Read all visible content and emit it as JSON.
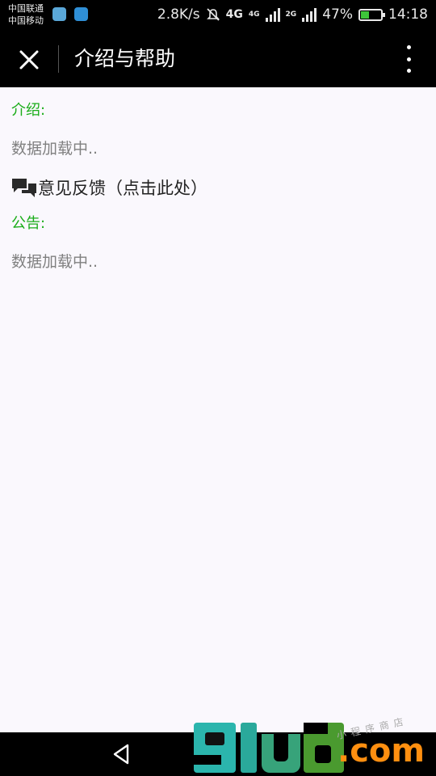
{
  "status_bar": {
    "carrier1": "中国联通",
    "carrier2": "中国移动",
    "speed": "2.8K/s",
    "net1": "4G",
    "net2": "4G",
    "net3": "2G",
    "battery": "47%",
    "battery_level": 0.47,
    "time": "14:18"
  },
  "header": {
    "title": "介绍与帮助",
    "close_icon": "close-icon",
    "more_icon": "more-vertical-icon"
  },
  "content": {
    "intro_label": "介绍:",
    "intro_text": "数据加载中..",
    "feedback_label": "意见反馈（点击此处）",
    "feedback_icon": "chat-bubbles-icon",
    "notice_label": "公告:",
    "notice_text": "数据加载中.."
  },
  "nav": {
    "back_icon": "back-triangle-icon",
    "home_icon": "home-circle-icon",
    "recent_icon": "recent-square-icon"
  },
  "watermark": {
    "brand": "91ud",
    "domain": ".com",
    "sub": "小程序商店"
  },
  "colors": {
    "accent_green": "#1aad19",
    "bar_bg": "#000000",
    "page_bg": "#faf8fd"
  }
}
